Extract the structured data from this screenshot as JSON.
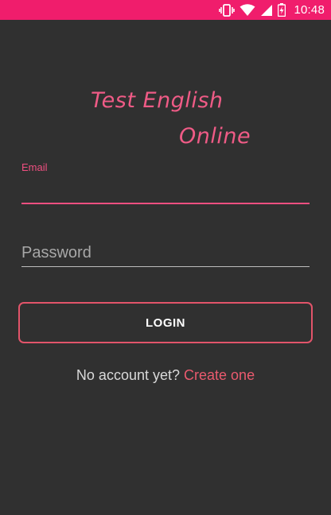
{
  "status_bar": {
    "time": "10:48",
    "bg_color": "#f01d6c",
    "icons": [
      "vibrate-icon",
      "wifi-icon",
      "signal-icon",
      "battery-charging-icon"
    ]
  },
  "logo": {
    "line1": "Test English",
    "line2": "Online",
    "color": "#ef5b86"
  },
  "form": {
    "email_label": "Email",
    "email_value": "",
    "password_placeholder": "Password",
    "password_value": "",
    "login_label": "LOGIN"
  },
  "signup": {
    "prompt": "No account yet? ",
    "link": "Create one"
  },
  "colors": {
    "background": "#303030",
    "accent": "#ef4f80",
    "button_border": "#e2546a",
    "link": "#ea5a6e"
  }
}
